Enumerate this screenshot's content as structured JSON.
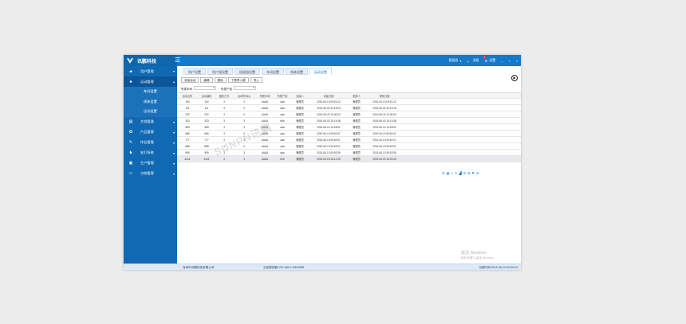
{
  "brand": {
    "name": "讯鹏科技"
  },
  "topbar": {
    "user": "管理员",
    "messages": "消息",
    "badge": "4",
    "settings": "设置",
    "win_min": "–",
    "win_max": "+",
    "win_close": "×"
  },
  "sidebar": {
    "items": [
      {
        "label": "用户管理",
        "icon": "users-icon",
        "glyph": "▰"
      },
      {
        "label": "运动管理",
        "icon": "sitemap-icon",
        "glyph": "♣"
      },
      {
        "label": "文档管理",
        "icon": "folder-icon",
        "glyph": "▤"
      },
      {
        "label": "产品管理",
        "icon": "box-icon",
        "glyph": "✪"
      },
      {
        "label": "作业管理",
        "icon": "wrench-icon",
        "glyph": "✎"
      },
      {
        "label": "安灯系统",
        "icon": "bell-icon",
        "glyph": "♞"
      },
      {
        "label": "生产管理",
        "icon": "lock-icon",
        "glyph": "▣"
      },
      {
        "label": "点检管理",
        "icon": "monitor-icon",
        "glyph": "▭"
      }
    ],
    "submenu": [
      "车间设置",
      "线体设置",
      "运动设置"
    ]
  },
  "tabs": [
    "用户设置",
    "用户组设置",
    "班组组设置",
    "车间设置",
    "线体设置",
    "运动设置"
  ],
  "toolbar": [
    "添加运动",
    "编辑",
    "删除",
    "下载导入模",
    "导入"
  ],
  "filters": {
    "workshop": "所属车间",
    "line": "所属产线"
  },
  "table": {
    "columns": [
      "运动名称",
      "运动编码",
      "播放方式",
      "运动时间(s)",
      "所属车间",
      "所属产线",
      "创建人",
      "创建日期",
      "更新人",
      "更新日期"
    ],
    "rows": [
      [
        "100",
        "100",
        "3",
        "3",
        "AAAA",
        "aaa",
        "管理员",
        "2019-06-13 09:51:12",
        "管理员",
        "2019-06-13 09:51:12"
      ],
      [
        "111",
        "111",
        "3",
        "3",
        "AAAA",
        "aaa",
        "管理员",
        "2019-06-03 10:19:03",
        "管理员",
        "2019-06-03 10:19:16"
      ],
      [
        "222",
        "222",
        "3",
        "3",
        "AAAA",
        "aaa",
        "管理员",
        "2019-05-22 11:06:03",
        "管理员",
        "2019-05-22 11:06:03"
      ],
      [
        "333",
        "333",
        "3",
        "3",
        "AAAA",
        "bbb",
        "管理员",
        "2019-06-03 10:19:38",
        "管理员",
        "2019-06-03 10:19:38"
      ],
      [
        "555",
        "555",
        "3",
        "3",
        "AAAA",
        "aaa",
        "管理员",
        "2019-06-13 14:28:01",
        "管理员",
        "2019-06-13 14:28:01"
      ],
      [
        "666",
        "666",
        "3",
        "3",
        "AAAA",
        "aaa",
        "管理员",
        "2019-06-13 09:52:47",
        "管理员",
        "2019-06-13 09:52:47"
      ],
      [
        "777",
        "777",
        "3",
        "3",
        "AAAA",
        "aaa",
        "管理员",
        "2019-06-13 09:52:47",
        "管理员",
        "2019-06-13 09:52:47"
      ],
      [
        "888",
        "888",
        "3",
        "3",
        "AAAA",
        "aaa",
        "管理员",
        "2019-06-13 09:53:21",
        "管理员",
        "2019-06-13 09:53:21"
      ],
      [
        "999",
        "999",
        "3",
        "3",
        "AAAA",
        "aaa",
        "管理员",
        "2019-06-13 09:52:55",
        "管理员",
        "2019-06-13 09:52:55"
      ],
      [
        "A111",
        "A111",
        "3",
        "3",
        "AAAA",
        "bbb",
        "管理员",
        "2019-05-15 16:12:49",
        "管理员",
        "2019-05-03 16:09:26"
      ]
    ]
  },
  "watermark": "SUNPN讯鹏",
  "windows_note": {
    "title": "激活 Windows",
    "subtitle": "转到“设置”以激活 Windows。"
  },
  "status": {
    "company": "深圳市讯鹏科技有限公司",
    "server": "当前服务器:192.168.0.166:5588",
    "time": "当前时间:2019-06-14 09:05:04"
  }
}
